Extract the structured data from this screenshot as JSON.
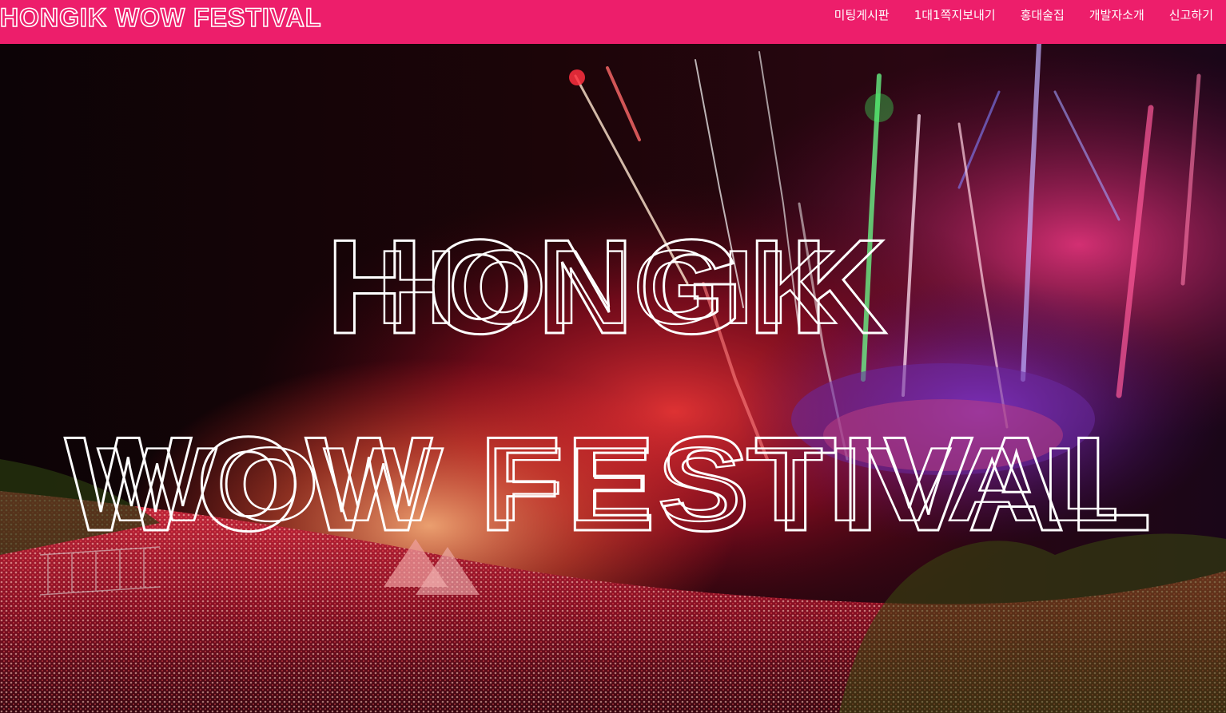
{
  "colors": {
    "brand_pink": "#ED1E6B",
    "nav_text": "#FFFFFF",
    "hero_title": "#FFFFFF"
  },
  "navbar": {
    "logo_text": "HONGIK WOW FESTIVAL",
    "items": [
      {
        "label": "미팅게시판"
      },
      {
        "label": "1대1쪽지보내기"
      },
      {
        "label": "홍대술집"
      },
      {
        "label": "개발자소개"
      },
      {
        "label": "신고하기"
      }
    ]
  },
  "hero": {
    "image_name": "festival-fireworks-crowd-photo",
    "title_line1": "HONGIK",
    "title_line2": "WOW FESTIVAL"
  }
}
